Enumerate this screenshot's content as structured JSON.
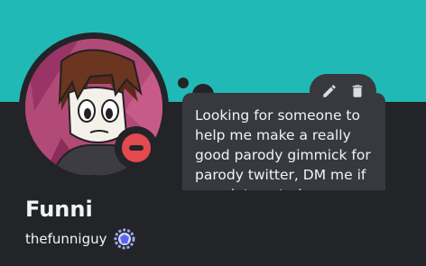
{
  "profile": {
    "display_name": "Funni",
    "username": "thefunniguy",
    "status": "do-not-disturb",
    "banner_color": "#21b9b6",
    "status_color": "#e24a4f"
  },
  "custom_note": {
    "text": "Looking for someone to help me make a really good parody gimmick for parody twitter, DM me if your interested"
  },
  "actions": {
    "edit_icon": "pencil-icon",
    "delete_icon": "trash-icon"
  },
  "badges": [
    {
      "icon": "hypesquad-badge-icon"
    }
  ]
}
